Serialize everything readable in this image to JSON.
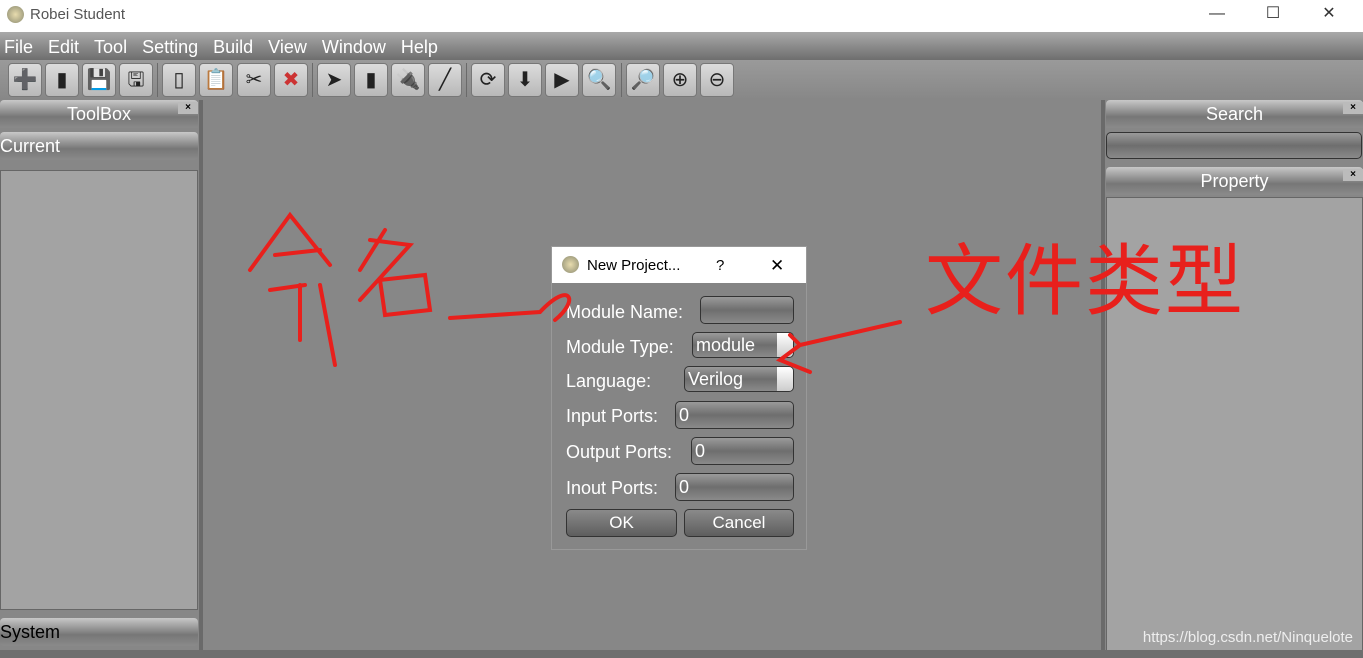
{
  "window": {
    "title": "Robei  Student",
    "minimize": "—",
    "maximize": "☐",
    "close": "✕"
  },
  "menu": [
    "File",
    "Edit",
    "Tool",
    "Setting",
    "Build",
    "View",
    "Window",
    "Help"
  ],
  "toolbar": [
    {
      "name": "new-project",
      "glyph": "➕"
    },
    {
      "name": "open",
      "glyph": "▮"
    },
    {
      "name": "save",
      "glyph": "💾"
    },
    {
      "name": "save-as",
      "glyph": "🖫"
    },
    {
      "name": "copy",
      "glyph": "▯"
    },
    {
      "name": "paste",
      "glyph": "📋"
    },
    {
      "name": "cut",
      "glyph": "✂"
    },
    {
      "name": "delete",
      "glyph": "✖"
    },
    {
      "name": "select",
      "glyph": "➤"
    },
    {
      "name": "chip",
      "glyph": "▮"
    },
    {
      "name": "pin",
      "glyph": "🔌"
    },
    {
      "name": "wire",
      "glyph": "╱"
    },
    {
      "name": "execute",
      "glyph": "⟳"
    },
    {
      "name": "download",
      "glyph": "⬇"
    },
    {
      "name": "simulate",
      "glyph": "▶"
    },
    {
      "name": "view-waveform",
      "glyph": "🔍"
    },
    {
      "name": "zoom-fit",
      "glyph": "🔎"
    },
    {
      "name": "zoom-in",
      "glyph": "⊕"
    },
    {
      "name": "zoom-out",
      "glyph": "⊖"
    }
  ],
  "toolbox": {
    "title": "ToolBox",
    "current": "Current",
    "system": "System",
    "close": "×"
  },
  "search": {
    "title": "Search",
    "value": "",
    "close": "×"
  },
  "property": {
    "title": "Property",
    "close": "×"
  },
  "dialog": {
    "title": "New Project...",
    "help": "?",
    "close": "✕",
    "module_name": {
      "label": "Module Name:",
      "value": ""
    },
    "module_type": {
      "label": "Module Type:",
      "value": "module"
    },
    "language": {
      "label": "Language:",
      "value": "Verilog"
    },
    "input_ports": {
      "label": "Input Ports:",
      "value": "0"
    },
    "output_ports": {
      "label": "Output Ports:",
      "value": "0"
    },
    "inout_ports": {
      "label": "Inout Ports:",
      "value": "0"
    },
    "ok": "OK",
    "cancel": "Cancel"
  },
  "annotations": {
    "left": "命名",
    "right": "文件类型",
    "color": "#e8201c"
  },
  "watermark": "https://blog.csdn.net/Ninquelote"
}
